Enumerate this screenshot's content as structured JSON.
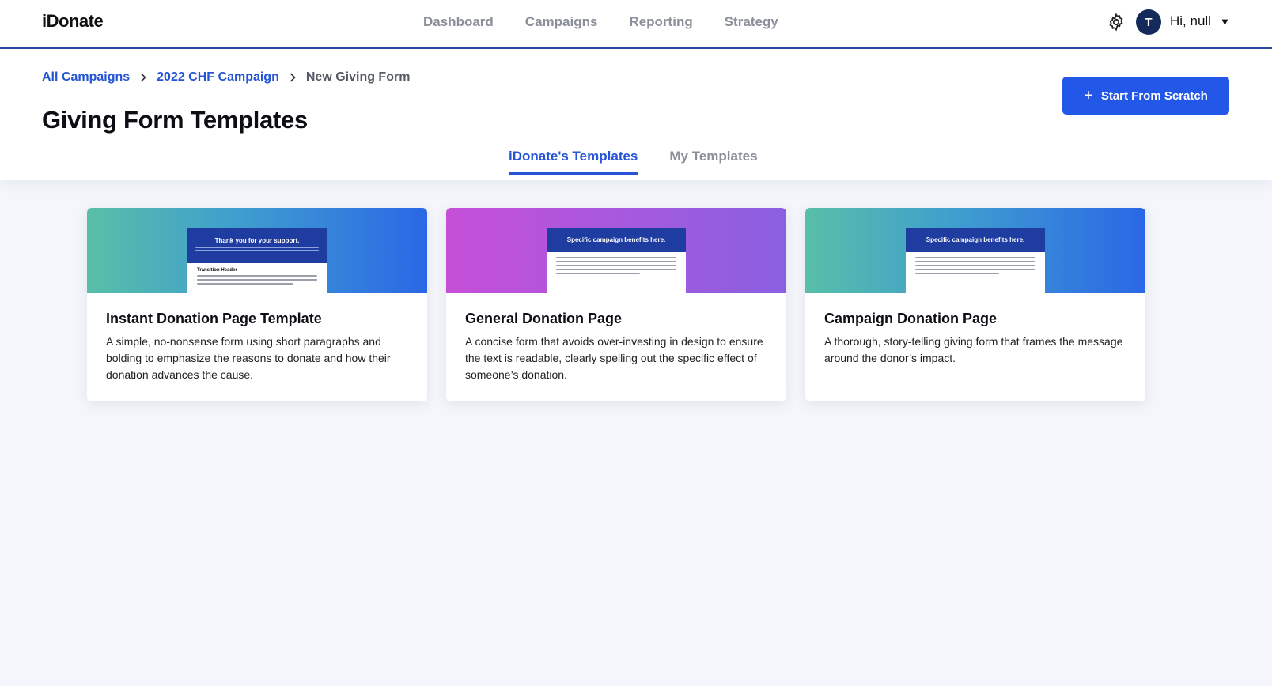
{
  "app": {
    "logo": "iDonate"
  },
  "nav": {
    "items": [
      {
        "label": "Dashboard"
      },
      {
        "label": "Campaigns"
      },
      {
        "label": "Reporting"
      },
      {
        "label": "Strategy"
      }
    ]
  },
  "user": {
    "initial": "T",
    "greeting": "Hi, null",
    "caret": "▼"
  },
  "breadcrumb": {
    "items": [
      "All Campaigns",
      "2022 CHF Campaign"
    ],
    "current": "New Giving Form"
  },
  "page": {
    "title": "Giving Form Templates"
  },
  "actions": {
    "start_from_scratch": "Start From Scratch",
    "plus_glyph": "+"
  },
  "tabs": [
    {
      "label": "iDonate's Templates",
      "active": true
    },
    {
      "label": "My Templates",
      "active": false
    }
  ],
  "cards": [
    {
      "title": "Instant Donation Page Template",
      "description": "A simple, no-nonsense form using short paragraphs and bolding to emphasize the reasons to donate and how their donation advances the cause.",
      "preview_heading": "Thank you for your support.",
      "preview_subheading": "Transition Header",
      "gradient": "teal"
    },
    {
      "title": "General Donation Page",
      "description": "A concise form that avoids over-investing in design to ensure the text is readable, clearly spelling out the specific effect of someone’s donation.",
      "preview_heading": "Specific campaign benefits here.",
      "gradient": "purple"
    },
    {
      "title": "Campaign Donation Page",
      "description": "A thorough, story-telling giving form that frames the message around the donor’s impact.",
      "preview_heading": "Specific campaign benefits here.",
      "gradient": "teal"
    }
  ],
  "colors": {
    "accent": "#2257e8",
    "link": "#2555d6",
    "nav_border": "#2a4a9c",
    "avatar_bg": "#142a5a",
    "page_bg": "#f4f6fb"
  }
}
